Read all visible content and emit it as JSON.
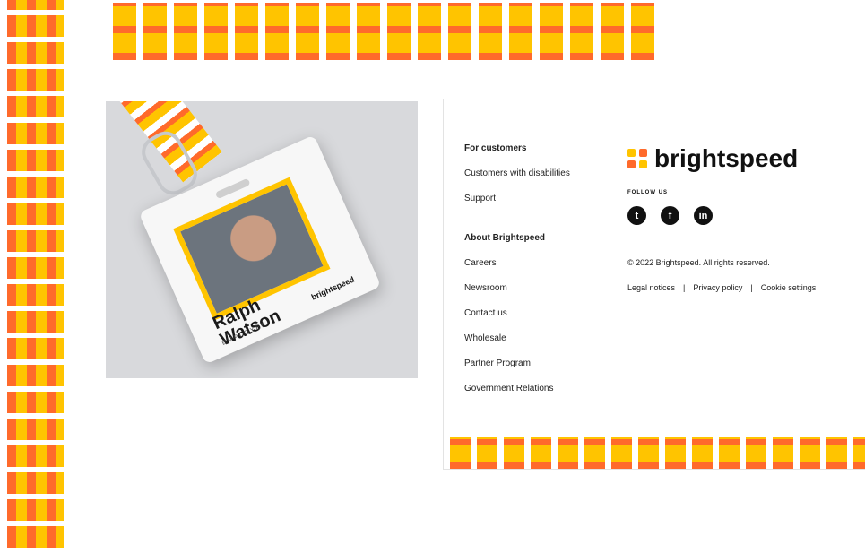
{
  "colors": {
    "yellow": "#ffc400",
    "orange": "#ff6a2b",
    "red": "#e8453c"
  },
  "badge": {
    "name_line1": "Ralph",
    "name_line2": "Watson",
    "role": "EMPLOYEE",
    "logo_text": "brightspeed"
  },
  "footer": {
    "links": [
      {
        "label": "For customers",
        "heading": true
      },
      {
        "label": "Customers with disabilities"
      },
      {
        "label": "Support"
      },
      {
        "label": "About Brightspeed",
        "heading": true
      },
      {
        "label": "Careers"
      },
      {
        "label": "Newsroom"
      },
      {
        "label": "Contact us"
      },
      {
        "label": "Wholesale"
      },
      {
        "label": "Partner Program"
      },
      {
        "label": "Government Relations"
      }
    ],
    "brand": "brightspeed",
    "follow_label": "FOLLOW US",
    "socials": [
      {
        "icon": "twitter-icon",
        "glyph": "t"
      },
      {
        "icon": "facebook-icon",
        "glyph": "f"
      },
      {
        "icon": "linkedin-icon",
        "glyph": "in"
      }
    ],
    "copyright": "© 2022 Brightspeed. All rights reserved.",
    "legal": {
      "legal_notices": "Legal notices",
      "sep": "|",
      "privacy": "Privacy policy",
      "cookies": "Cookie settings"
    }
  }
}
